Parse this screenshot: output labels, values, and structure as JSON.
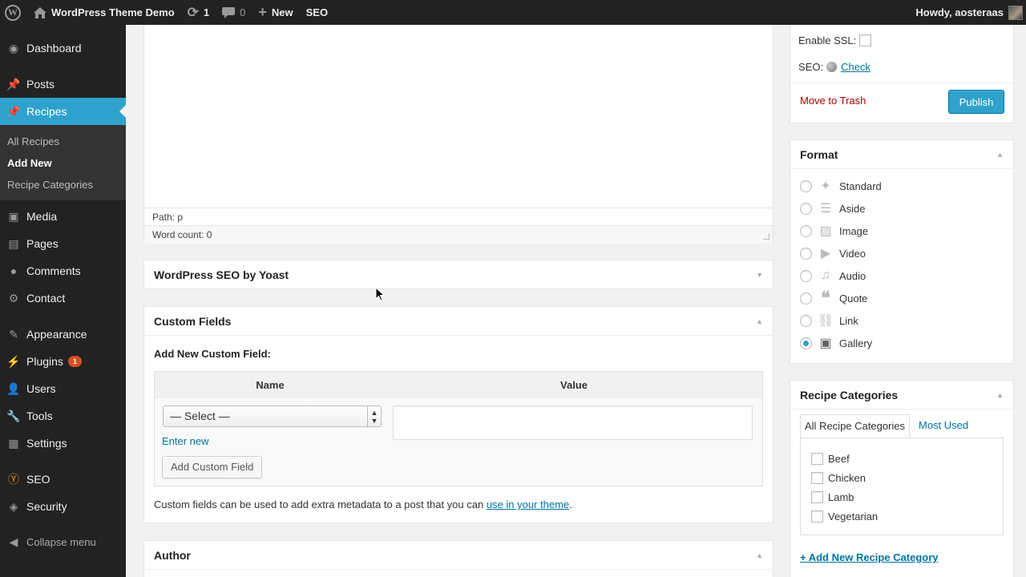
{
  "adminbar": {
    "site_name": "WordPress Theme Demo",
    "updates_count": "1",
    "comments_count": "0",
    "new_label": "New",
    "seo_label": "SEO",
    "howdy": "Howdy, aosteraas"
  },
  "sidebar": {
    "items": [
      {
        "label": "Dashboard"
      },
      {
        "label": "Posts"
      },
      {
        "label": "Recipes"
      },
      {
        "label": "Media"
      },
      {
        "label": "Pages"
      },
      {
        "label": "Comments"
      },
      {
        "label": "Contact"
      },
      {
        "label": "Appearance"
      },
      {
        "label": "Plugins",
        "badge": "1"
      },
      {
        "label": "Users"
      },
      {
        "label": "Tools"
      },
      {
        "label": "Settings"
      },
      {
        "label": "SEO"
      },
      {
        "label": "Security"
      }
    ],
    "recipes_submenu": [
      "All Recipes",
      "Add New",
      "Recipe Categories"
    ],
    "collapse_label": "Collapse menu"
  },
  "editor": {
    "path": "Path: p",
    "word_count": "Word count: 0"
  },
  "seo_box": {
    "title": "WordPress SEO by Yoast"
  },
  "custom_fields": {
    "title": "Custom Fields",
    "add_new_label": "Add New Custom Field:",
    "col_name": "Name",
    "col_value": "Value",
    "select_value": "— Select —",
    "enter_new": "Enter new",
    "add_button": "Add Custom Field",
    "note_prefix": "Custom fields can be used to add extra metadata to a post that you can ",
    "note_link": "use in your theme",
    "note_suffix": "."
  },
  "author_box": {
    "title": "Author"
  },
  "publish": {
    "ssl_label": "Enable SSL:",
    "seo_label": "SEO:",
    "seo_check": "Check",
    "trash": "Move to Trash",
    "publish_button": "Publish"
  },
  "format": {
    "title": "Format",
    "options": [
      "Standard",
      "Aside",
      "Image",
      "Video",
      "Audio",
      "Quote",
      "Link",
      "Gallery"
    ],
    "selected": "Gallery"
  },
  "recipe_categories": {
    "title": "Recipe Categories",
    "tab_all": "All Recipe Categories",
    "tab_used": "Most Used",
    "categories": [
      "Beef",
      "Chicken",
      "Lamb",
      "Vegetarian"
    ],
    "add_new": "+ Add New Recipe Category"
  },
  "colors": {
    "accent": "#2ea2cc",
    "link": "#0074a2",
    "trash": "#aa0000",
    "admin_bar": "#222222"
  }
}
